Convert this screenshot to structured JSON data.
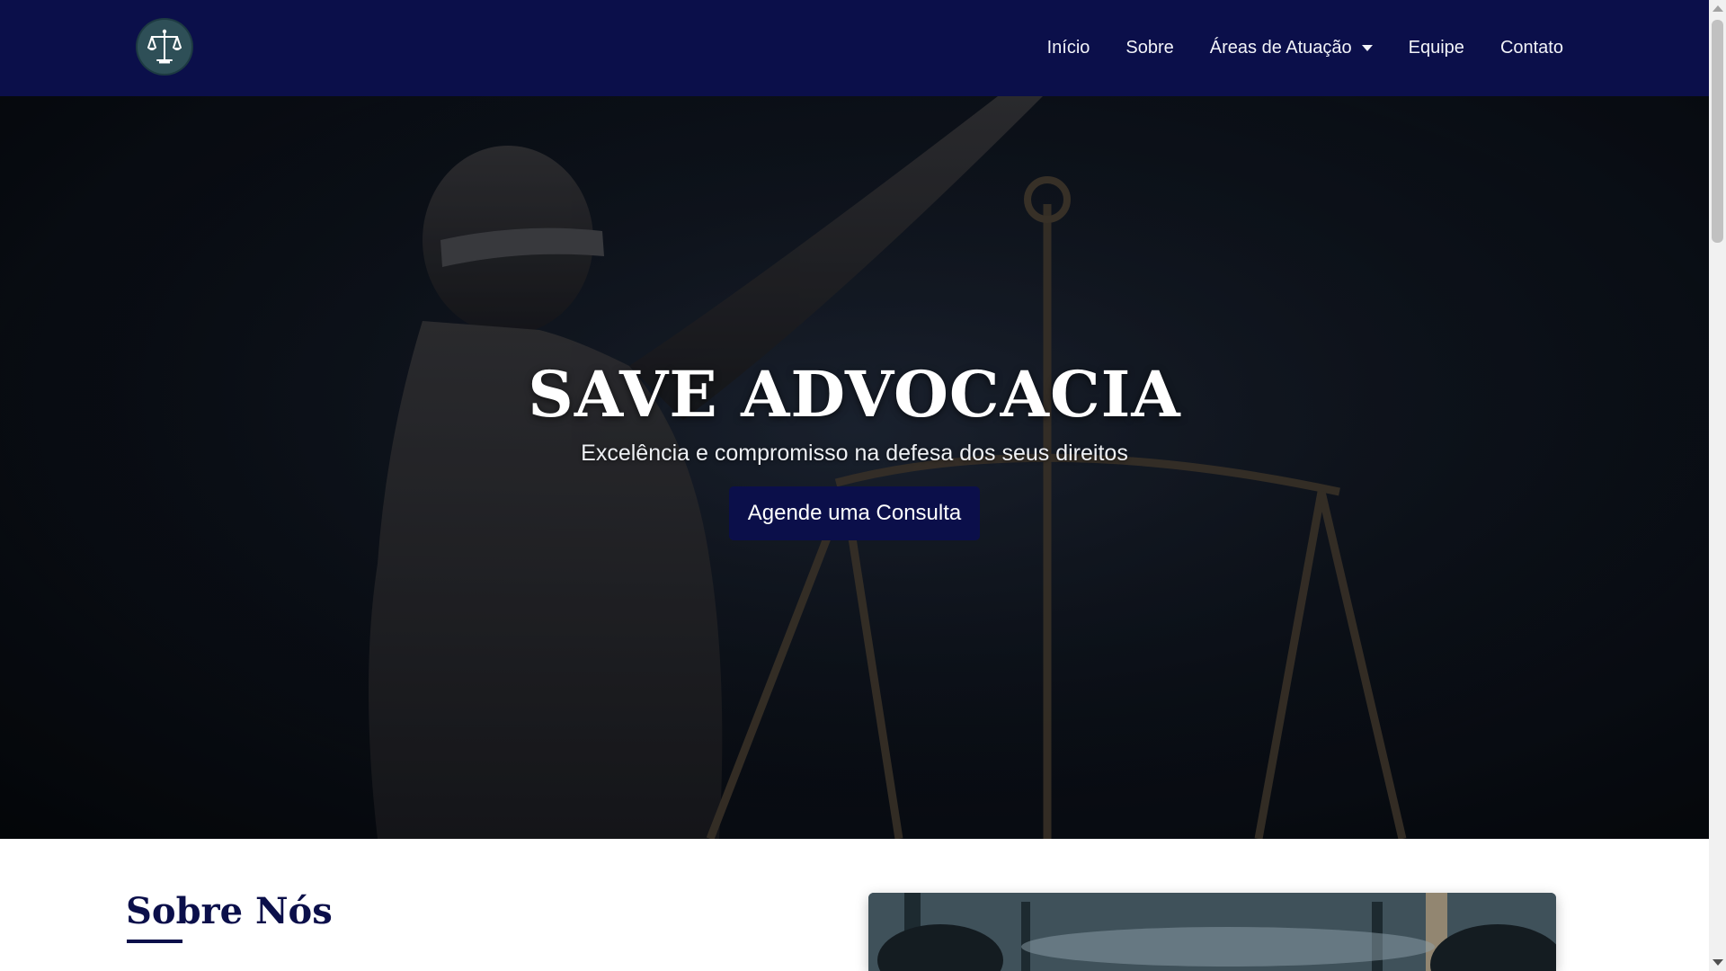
{
  "nav": {
    "logo_alt": "scales-of-justice logo",
    "items": [
      {
        "label": "Início"
      },
      {
        "label": "Sobre"
      },
      {
        "label": "Áreas de Atuação",
        "has_dropdown": true
      },
      {
        "label": "Equipe"
      },
      {
        "label": "Contato"
      }
    ]
  },
  "hero": {
    "title": "SAVE ADVOCACIA",
    "subtitle": "Excelência e compromisso na defesa dos seus direitos",
    "cta_label": "Agende uma Consulta"
  },
  "about": {
    "title": "Sobre Nós"
  },
  "colors": {
    "primary": "#0b0f4a",
    "logo_bg": "#2e4f57",
    "white": "#ffffff"
  }
}
